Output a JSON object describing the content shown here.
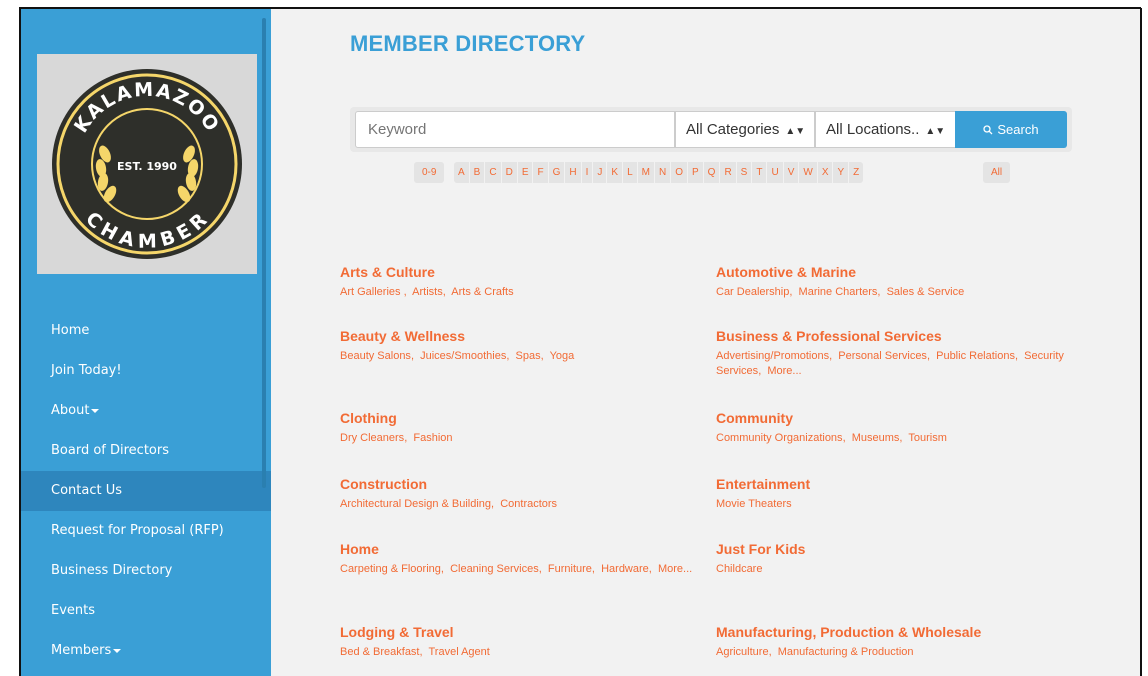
{
  "sidebar": {
    "nav": [
      {
        "label": "Home",
        "caret": false,
        "active": false
      },
      {
        "label": "Join Today!",
        "caret": false,
        "active": false
      },
      {
        "label": "About",
        "caret": true,
        "active": false
      },
      {
        "label": "Board of Directors",
        "caret": false,
        "active": false
      },
      {
        "label": "Contact Us",
        "caret": false,
        "active": true
      },
      {
        "label": "Request for Proposal (RFP)",
        "caret": false,
        "active": false
      },
      {
        "label": "Business Directory",
        "caret": false,
        "active": false
      },
      {
        "label": "Events",
        "caret": false,
        "active": false
      },
      {
        "label": "Members",
        "caret": true,
        "active": false
      }
    ],
    "logo": {
      "top_text": "KALAMAZOO",
      "middle_text": "EST. 1990",
      "bottom_text": "CHAMBER"
    }
  },
  "main": {
    "title": "MEMBER DIRECTORY",
    "search": {
      "keyword_placeholder": "Keyword",
      "category_select": "All Categories",
      "location_select": "All Locations..",
      "button_label": "Search"
    },
    "alphabet": {
      "numeric": "0-9",
      "letters": [
        "A",
        "B",
        "C",
        "D",
        "E",
        "F",
        "G",
        "H",
        "I",
        "J",
        "K",
        "L",
        "M",
        "N",
        "O",
        "P",
        "Q",
        "R",
        "S",
        "T",
        "U",
        "V",
        "W",
        "X",
        "Y",
        "Z"
      ],
      "all": "All"
    },
    "categories_left": [
      {
        "title": "Arts & Culture",
        "subs": [
          "Art Galleries ",
          "Artists",
          "Arts & Crafts"
        ]
      },
      {
        "title": "Beauty & Wellness",
        "subs": [
          "Beauty Salons",
          "Juices/Smoothies",
          "Spas",
          "Yoga"
        ]
      },
      {
        "title": "Clothing",
        "subs": [
          "Dry Cleaners",
          "Fashion"
        ]
      },
      {
        "title": "Construction",
        "subs": [
          "Architectural Design & Building",
          "Contractors"
        ]
      },
      {
        "title": "Home",
        "subs": [
          "Carpeting & Flooring",
          "Cleaning Services",
          "Furniture",
          "Hardware",
          "More..."
        ]
      },
      {
        "title": "Lodging & Travel",
        "subs": [
          "Bed & Breakfast",
          "Travel Agent"
        ]
      }
    ],
    "categories_right": [
      {
        "title": "Automotive & Marine",
        "subs": [
          "Car Dealership",
          "Marine Charters",
          "Sales & Service"
        ]
      },
      {
        "title": "Business & Professional Services",
        "subs": [
          "Advertising/Promotions",
          "Personal Services",
          "Public Relations",
          "Security Services",
          "More..."
        ]
      },
      {
        "title": "Community",
        "subs": [
          "Community Organizations",
          "Museums",
          "Tourism"
        ]
      },
      {
        "title": "Entertainment",
        "subs": [
          "Movie Theaters"
        ]
      },
      {
        "title": "Just For Kids",
        "subs": [
          "Childcare"
        ]
      },
      {
        "title": "Manufacturing, Production & Wholesale",
        "subs": [
          "Agriculture",
          "Manufacturing & Production"
        ]
      }
    ],
    "colors": {
      "accent_blue": "#3a9fd6",
      "link_orange": "#f26b35",
      "sidebar_active": "#2e86bd"
    }
  }
}
